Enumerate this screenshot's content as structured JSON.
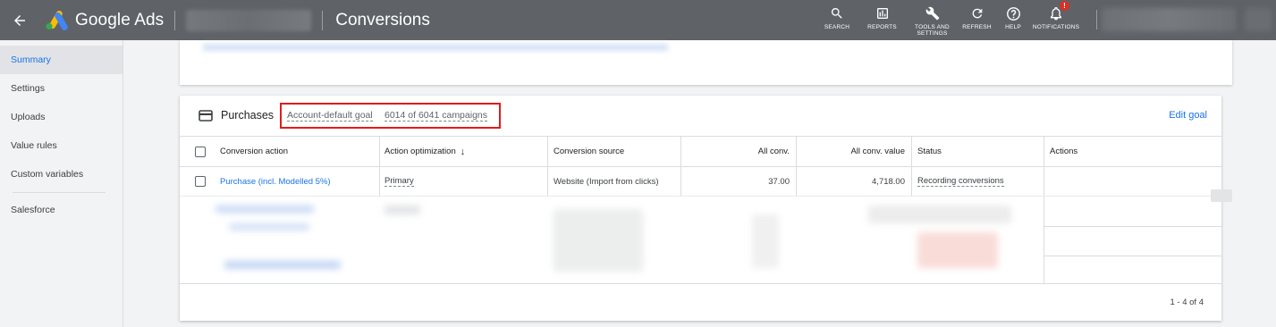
{
  "topbar": {
    "app_name": "Google Ads",
    "page_title": "Conversions",
    "tools": [
      {
        "label": "SEARCH",
        "icon": "search-icon"
      },
      {
        "label": "REPORTS",
        "icon": "reports-icon"
      },
      {
        "label": "TOOLS AND SETTINGS",
        "icon": "wrench-icon"
      },
      {
        "label": "REFRESH",
        "icon": "refresh-icon"
      },
      {
        "label": "HELP",
        "icon": "help-icon"
      },
      {
        "label": "NOTIFICATIONS",
        "icon": "bell-icon",
        "badge": "!"
      }
    ]
  },
  "sidebar": {
    "items": [
      {
        "label": "Summary",
        "active": true
      },
      {
        "label": "Settings"
      },
      {
        "label": "Uploads"
      },
      {
        "label": "Value rules"
      },
      {
        "label": "Custom variables"
      },
      {
        "label": "Salesforce"
      }
    ]
  },
  "goal": {
    "title": "Purchases",
    "default_goal": "Account-default goal",
    "campaigns": "6014 of 6041 campaigns",
    "edit_label": "Edit goal"
  },
  "table": {
    "headers": [
      "Conversion action",
      "Action optimization",
      "Conversion source",
      "All conv.",
      "All conv. value",
      "Status",
      "Actions"
    ],
    "rows": [
      {
        "conversion_action": "Purchase (incl. Modelled 5%)",
        "action_optimization": "Primary",
        "conversion_source": "Website (Import from clicks)",
        "all_conv": "37.00",
        "all_conv_value": "4,718.00",
        "status": "Recording conversions",
        "actions": ""
      }
    ]
  },
  "pager": "1 - 4 of 4",
  "colors": {
    "topbar": "#5f6368",
    "accent": "#1a73e8",
    "highlight": "#e01b1b",
    "logo_yellow": "#fbbc04",
    "logo_blue": "#4285f4",
    "logo_green": "#34a853"
  }
}
